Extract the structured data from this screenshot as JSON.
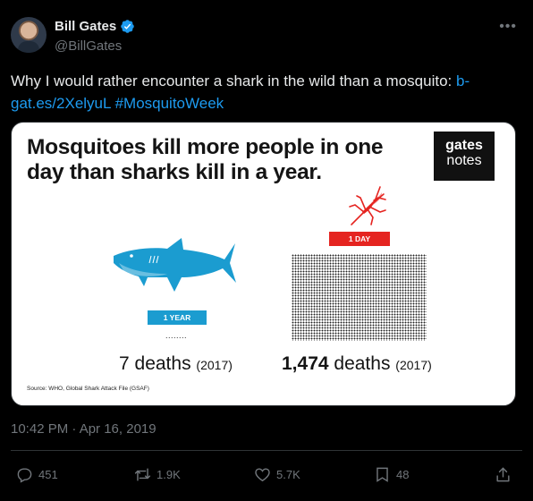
{
  "author": {
    "name": "Bill Gates",
    "handle": "@BillGates"
  },
  "tweet": {
    "text_plain": "Why I would rather encounter a shark in the wild than a mosquito: ",
    "link": "b-gat.es/2XelyuL",
    "hashtag": "#MosquitoWeek",
    "timestamp": "10:42 PM · Apr 16, 2019"
  },
  "infographic": {
    "headline": "Mosquitoes kill more people in one day than sharks kill in a year.",
    "logo_line1": "gates",
    "logo_line2": "notes",
    "shark_badge": "1 YEAR",
    "shark_dots": "........",
    "shark_deaths": "7 deaths",
    "shark_year": "(2017)",
    "mosquito_badge": "1 DAY",
    "mosquito_deaths_number": "1,474",
    "mosquito_deaths_label": " deaths",
    "mosquito_year": "(2017)",
    "source": "Source: WHO, Global Shark Attack File (GSAF)"
  },
  "actions": {
    "replies": "451",
    "reposts": "1.9K",
    "likes": "5.7K",
    "bookmarks": "48"
  },
  "colors": {
    "link": "#1d9bf0",
    "shark": "#1b9cd0",
    "mosquito_accent": "#e52420",
    "muted": "#71767b"
  },
  "icons": [
    "verified-badge-icon",
    "more-icon",
    "reply-icon",
    "repost-icon",
    "like-icon",
    "bookmark-icon",
    "share-icon"
  ]
}
